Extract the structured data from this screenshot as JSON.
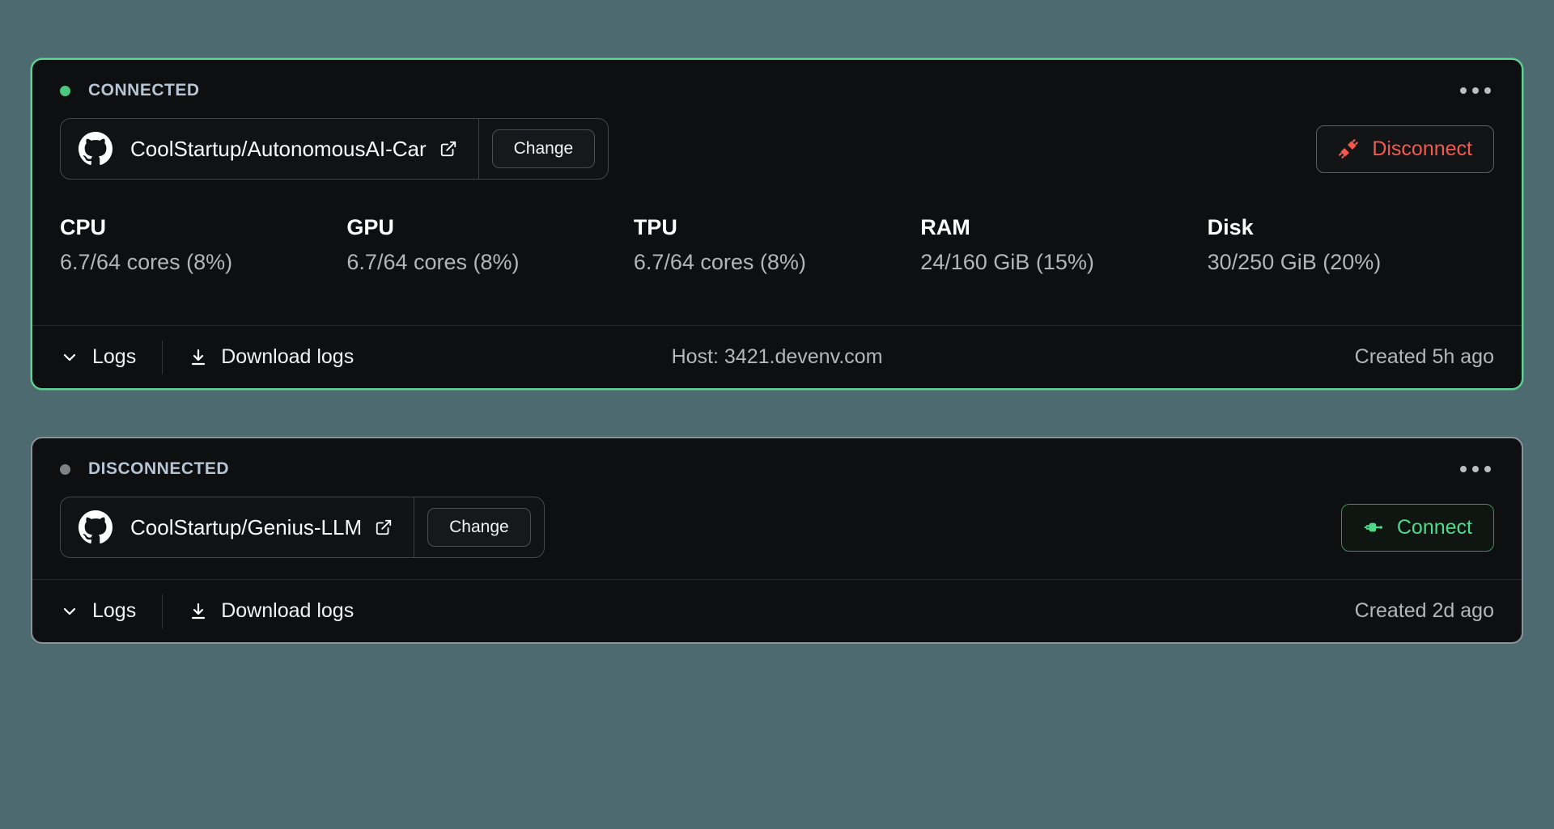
{
  "colors": {
    "page_background": "#4c6a70",
    "card_background": "#0e0f11",
    "connected_border": "#5ed894",
    "disconnected_border": "#8d9499",
    "status_text": "#b7c6d6",
    "connected_dot": "#4cc97f",
    "disconnected_dot": "#7d8287",
    "disconnect_red": "#f4594f",
    "connect_green": "#4ddb8a"
  },
  "cards": [
    {
      "status_label": "CONNECTED",
      "status_state": "connected",
      "menu_icon": "ellipsis-horizontal-icon",
      "repo": {
        "provider_icon": "github-icon",
        "name": "CoolStartup/AutonomousAI-Car",
        "external_link_icon": "external-link-icon",
        "change_label": "Change"
      },
      "action": {
        "label": "Disconnect",
        "icon": "plug-disconnect-icon"
      },
      "metrics": [
        {
          "label": "CPU",
          "value": "6.7/64 cores (8%)"
        },
        {
          "label": "GPU",
          "value": "6.7/64 cores (8%)"
        },
        {
          "label": "TPU",
          "value": "6.7/64 cores (8%)"
        },
        {
          "label": "RAM",
          "value": "24/160 GiB (15%)"
        },
        {
          "label": "Disk",
          "value": "30/250 GiB (20%)"
        }
      ],
      "footer": {
        "logs_label": "Logs",
        "logs_icon": "chevron-down-icon",
        "download_label": "Download logs",
        "download_icon": "download-icon",
        "host": "Host: 3421.devenv.com",
        "created": "Created 5h ago"
      }
    },
    {
      "status_label": "DISCONNECTED",
      "status_state": "disconnected",
      "menu_icon": "ellipsis-horizontal-icon",
      "repo": {
        "provider_icon": "github-icon",
        "name": "CoolStartup/Genius-LLM",
        "external_link_icon": "external-link-icon",
        "change_label": "Change"
      },
      "action": {
        "label": "Connect",
        "icon": "plug-connect-icon"
      },
      "footer": {
        "logs_label": "Logs",
        "logs_icon": "chevron-down-icon",
        "download_label": "Download logs",
        "download_icon": "download-icon",
        "host": "",
        "created": "Created 2d ago"
      }
    }
  ]
}
